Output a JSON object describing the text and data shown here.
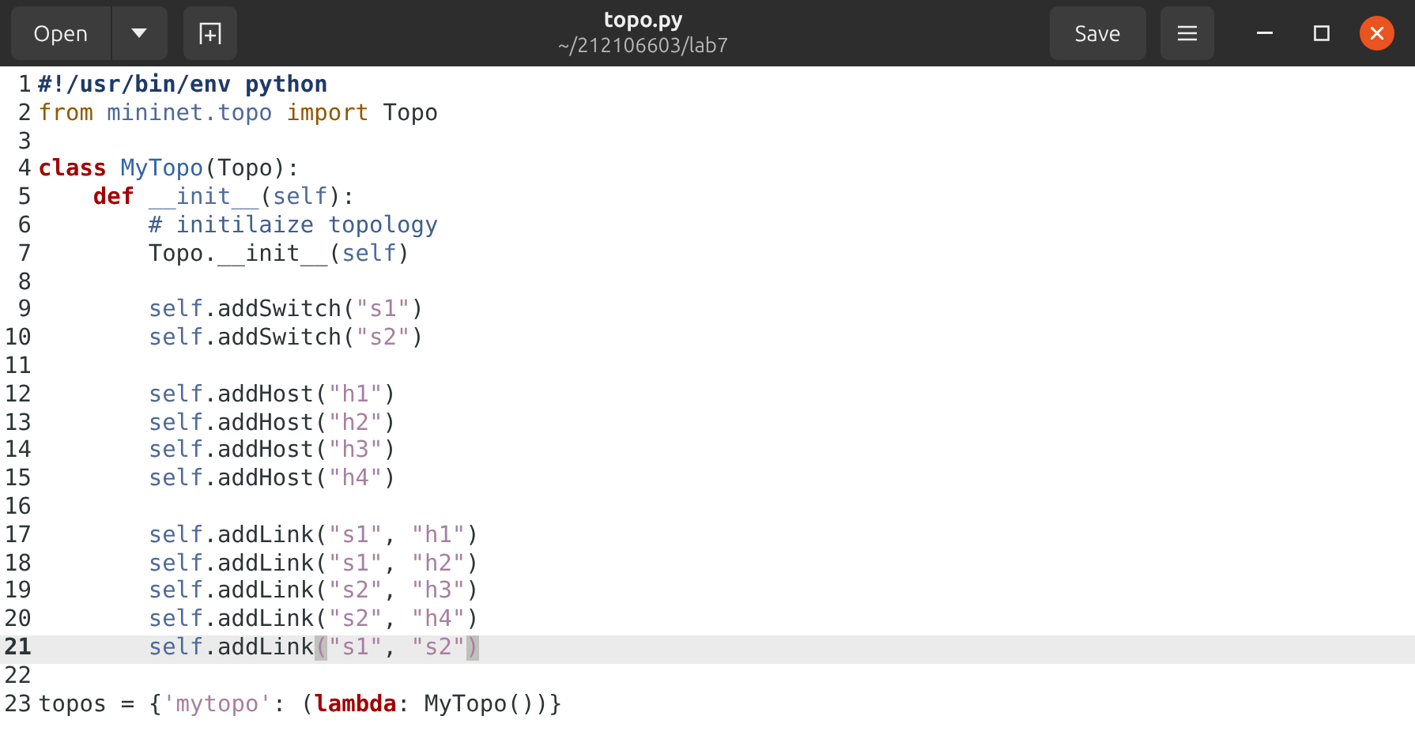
{
  "header": {
    "open_button": "Open",
    "title": "topo.py",
    "subtitle": "~/212106603/lab7",
    "save_button": "Save"
  },
  "editor": {
    "lines": [
      {
        "number": "1",
        "current": false,
        "tokens": [
          {
            "text": "#!/usr/bin/env python",
            "kind": "shebang"
          }
        ]
      },
      {
        "number": "2",
        "current": false,
        "tokens": [
          {
            "text": "from ",
            "kind": "import"
          },
          {
            "text": "mininet.topo ",
            "kind": "name"
          },
          {
            "text": "import",
            "kind": "import"
          },
          {
            "text": " Topo",
            "kind": "plain"
          }
        ]
      },
      {
        "number": "3",
        "current": false
      },
      {
        "number": "4",
        "current": false,
        "tokens": [
          {
            "text": "class ",
            "kind": "keyword"
          },
          {
            "text": "MyTopo",
            "kind": "classname"
          },
          {
            "text": "(Topo):",
            "kind": "plain"
          }
        ]
      },
      {
        "number": "5",
        "current": false,
        "tokens": [
          {
            "text": "    def ",
            "kind": "keyword"
          },
          {
            "text": "__init__",
            "kind": "name"
          },
          {
            "text": "(",
            "kind": "plain"
          },
          {
            "text": "self",
            "kind": "name"
          },
          {
            "text": "):",
            "kind": "plain"
          }
        ]
      },
      {
        "number": "6",
        "current": false,
        "tokens": [
          {
            "text": "        # initilaize topology",
            "kind": "comment"
          }
        ]
      },
      {
        "number": "7",
        "current": false,
        "tokens": [
          {
            "text": "        Topo.__init__(",
            "kind": "plain"
          },
          {
            "text": "self",
            "kind": "name"
          },
          {
            "text": ")",
            "kind": "plain"
          }
        ]
      },
      {
        "number": "8",
        "current": false
      },
      {
        "number": "9",
        "current": false,
        "tokens": [
          {
            "text": "        self",
            "kind": "name"
          },
          {
            "text": ".addSwitch(",
            "kind": "plain"
          },
          {
            "text": "\"s1\"",
            "kind": "string"
          },
          {
            "text": ")",
            "kind": "plain"
          }
        ]
      },
      {
        "number": "10",
        "current": false,
        "tokens": [
          {
            "text": "        self",
            "kind": "name"
          },
          {
            "text": ".addSwitch(",
            "kind": "plain"
          },
          {
            "text": "\"s2\"",
            "kind": "string"
          },
          {
            "text": ")",
            "kind": "plain"
          }
        ]
      },
      {
        "number": "11",
        "current": false
      },
      {
        "number": "12",
        "current": false,
        "tokens": [
          {
            "text": "        self",
            "kind": "name"
          },
          {
            "text": ".addHost(",
            "kind": "plain"
          },
          {
            "text": "\"h1\"",
            "kind": "string"
          },
          {
            "text": ")",
            "kind": "plain"
          }
        ]
      },
      {
        "number": "13",
        "current": false,
        "tokens": [
          {
            "text": "        self",
            "kind": "name"
          },
          {
            "text": ".addHost(",
            "kind": "plain"
          },
          {
            "text": "\"h2\"",
            "kind": "string"
          },
          {
            "text": ")",
            "kind": "plain"
          }
        ]
      },
      {
        "number": "14",
        "current": false,
        "tokens": [
          {
            "text": "        self",
            "kind": "name"
          },
          {
            "text": ".addHost(",
            "kind": "plain"
          },
          {
            "text": "\"h3\"",
            "kind": "string"
          },
          {
            "text": ")",
            "kind": "plain"
          }
        ]
      },
      {
        "number": "15",
        "current": false,
        "tokens": [
          {
            "text": "        self",
            "kind": "name"
          },
          {
            "text": ".addHost(",
            "kind": "plain"
          },
          {
            "text": "\"h4\"",
            "kind": "string"
          },
          {
            "text": ")",
            "kind": "plain"
          }
        ]
      },
      {
        "number": "16",
        "current": false
      },
      {
        "number": "17",
        "current": false,
        "tokens": [
          {
            "text": "        self",
            "kind": "name"
          },
          {
            "text": ".addLink(",
            "kind": "plain"
          },
          {
            "text": "\"s1\"",
            "kind": "string"
          },
          {
            "text": ", ",
            "kind": "plain"
          },
          {
            "text": "\"h1\"",
            "kind": "string"
          },
          {
            "text": ")",
            "kind": "plain"
          }
        ]
      },
      {
        "number": "18",
        "current": false,
        "tokens": [
          {
            "text": "        self",
            "kind": "name"
          },
          {
            "text": ".addLink(",
            "kind": "plain"
          },
          {
            "text": "\"s1\"",
            "kind": "string"
          },
          {
            "text": ", ",
            "kind": "plain"
          },
          {
            "text": "\"h2\"",
            "kind": "string"
          },
          {
            "text": ")",
            "kind": "plain"
          }
        ]
      },
      {
        "number": "19",
        "current": false,
        "tokens": [
          {
            "text": "        self",
            "kind": "name"
          },
          {
            "text": ".addLink(",
            "kind": "plain"
          },
          {
            "text": "\"s2\"",
            "kind": "string"
          },
          {
            "text": ", ",
            "kind": "plain"
          },
          {
            "text": "\"h3\"",
            "kind": "string"
          },
          {
            "text": ")",
            "kind": "plain"
          }
        ]
      },
      {
        "number": "20",
        "current": false,
        "tokens": [
          {
            "text": "        self",
            "kind": "name"
          },
          {
            "text": ".addLink(",
            "kind": "plain"
          },
          {
            "text": "\"s2\"",
            "kind": "string"
          },
          {
            "text": ", ",
            "kind": "plain"
          },
          {
            "text": "\"h4\"",
            "kind": "string"
          },
          {
            "text": ")",
            "kind": "plain"
          }
        ]
      },
      {
        "number": "21",
        "current": true,
        "tokens": [
          {
            "text": "        self",
            "kind": "name"
          },
          {
            "text": ".addLink",
            "kind": "plain"
          },
          {
            "text": "(",
            "kind": "bracket"
          },
          {
            "text": "\"s1\"",
            "kind": "string"
          },
          {
            "text": ", ",
            "kind": "plain"
          },
          {
            "text": "\"s2\"",
            "kind": "string"
          },
          {
            "text": ")",
            "kind": "bracket"
          }
        ]
      },
      {
        "number": "22",
        "current": false
      },
      {
        "number": "23",
        "current": false,
        "tokens": [
          {
            "text": "topos = {",
            "kind": "plain"
          },
          {
            "text": "'mytopo'",
            "kind": "string"
          },
          {
            "text": ": (",
            "kind": "plain"
          },
          {
            "text": "lambda",
            "kind": "keyword"
          },
          {
            "text": ": MyTopo())}",
            "kind": "plain"
          }
        ]
      }
    ]
  }
}
